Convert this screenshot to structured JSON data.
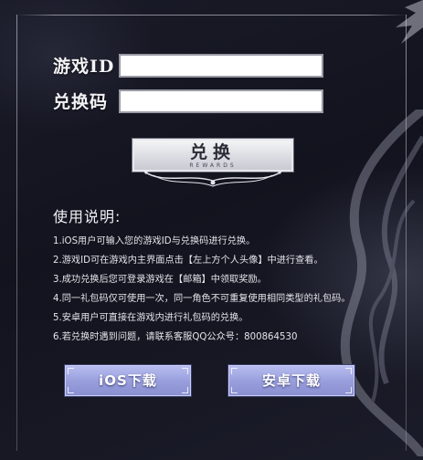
{
  "form": {
    "game_id_label": "游戏ID",
    "game_id_value": "",
    "code_label": "兑换码",
    "code_value": ""
  },
  "redeem_button": {
    "label": "兑换",
    "sublabel": "REWARDS"
  },
  "instructions": {
    "title": "使用说明:",
    "items": [
      "1.iOS用户可输入您的游戏ID与兑换码进行兑换。",
      "2.游戏ID可在游戏内主界面点击【左上方个人头像】中进行查看。",
      "3.成功兑换后您可登录游戏在【邮箱】中领取奖励。",
      "4.同一礼包码仅可使用一次，同一角色不可重复使用相同类型的礼包码。",
      "5.安卓用户可直接在游戏内进行礼包码的兑换。",
      "6.若兑换时遇到问题，请联系客服QQ公众号：800864530"
    ]
  },
  "downloads": {
    "ios_label": "iOS下载",
    "android_label": "安卓下载"
  },
  "colors": {
    "background": "#12131e",
    "download_button": "#9aa0dd",
    "redeem_button": "#dcdde3"
  }
}
